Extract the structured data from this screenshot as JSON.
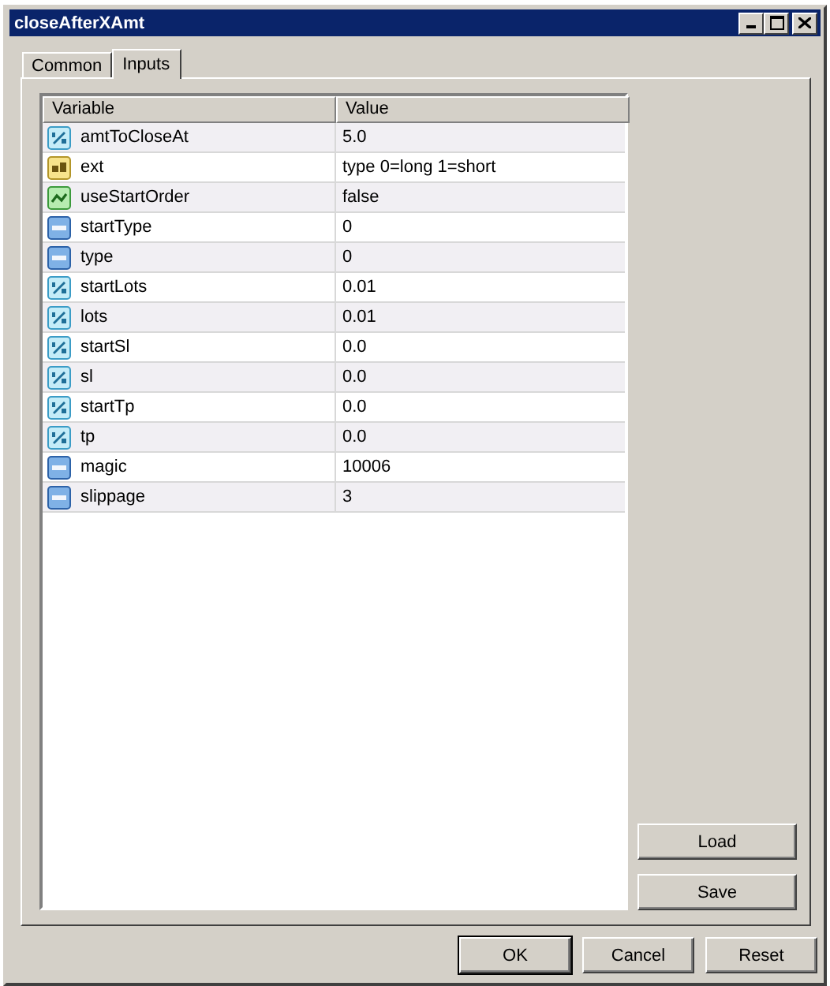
{
  "window": {
    "title": "closeAfterXAmt"
  },
  "tabs": [
    {
      "label": "Common",
      "selected": false
    },
    {
      "label": "Inputs",
      "selected": true
    }
  ],
  "table": {
    "columns": [
      "Variable",
      "Value"
    ],
    "rows": [
      {
        "kind": "double",
        "variable": "amtToCloseAt",
        "value": "5.0"
      },
      {
        "kind": "string",
        "variable": "ext",
        "value": "type 0=long 1=short"
      },
      {
        "kind": "bool",
        "variable": "useStartOrder",
        "value": "false"
      },
      {
        "kind": "int",
        "variable": "startType",
        "value": "0"
      },
      {
        "kind": "int",
        "variable": "type",
        "value": "0"
      },
      {
        "kind": "double",
        "variable": "startLots",
        "value": "0.01"
      },
      {
        "kind": "double",
        "variable": "lots",
        "value": "0.01"
      },
      {
        "kind": "double",
        "variable": "startSl",
        "value": "0.0"
      },
      {
        "kind": "double",
        "variable": "sl",
        "value": "0.0"
      },
      {
        "kind": "double",
        "variable": "startTp",
        "value": "0.0"
      },
      {
        "kind": "double",
        "variable": "tp",
        "value": "0.0"
      },
      {
        "kind": "int",
        "variable": "magic",
        "value": "10006"
      },
      {
        "kind": "int",
        "variable": "slippage",
        "value": "3"
      }
    ]
  },
  "side_buttons": [
    "Load",
    "Save"
  ],
  "buttons": [
    "OK",
    "Cancel",
    "Reset"
  ]
}
